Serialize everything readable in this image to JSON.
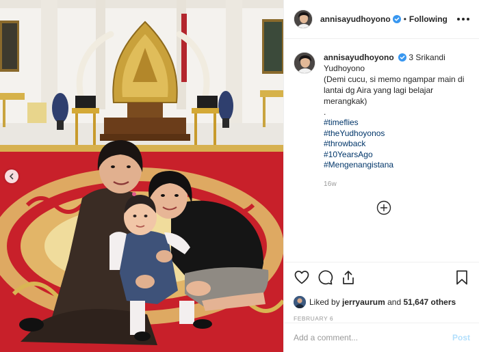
{
  "photo": {
    "alt_subject": "family-photo",
    "nav_icon": "chevron-left-icon"
  },
  "header": {
    "username": "annisayudhoyono",
    "verified_icon": "verified-badge-icon",
    "separator": "•",
    "follow_status": "Following",
    "more_icon": "more-options-icon"
  },
  "caption": {
    "username": "annisayudhoyono",
    "text": "3 Srikandi\nYudhoyono\n(Demi cucu, si memo ngampar main di lantai dg Aira yang lagi belajar merangkak)\n.",
    "hashtags": [
      "#timeflies",
      "#theYudhoyonos",
      "#throwback",
      "#10YearsAgo",
      "#Mengenangistana"
    ],
    "age": "16w",
    "load_more_icon": "plus-circle-icon"
  },
  "actions": {
    "like_icon": "heart-icon",
    "comment_icon": "comment-icon",
    "share_icon": "share-icon",
    "save_icon": "bookmark-icon"
  },
  "likes": {
    "prefix": "Liked by",
    "user": "jerryaurum",
    "middle": "and",
    "count": "51,647 others"
  },
  "date": "FEBRUARY 6",
  "comment": {
    "placeholder": "Add a comment...",
    "post_label": "Post"
  },
  "colors": {
    "link": "#003569",
    "verified": "#3897f0",
    "post_disabled": "#b2dffc",
    "muted": "#999999",
    "carpet_red": "#c8202a"
  }
}
